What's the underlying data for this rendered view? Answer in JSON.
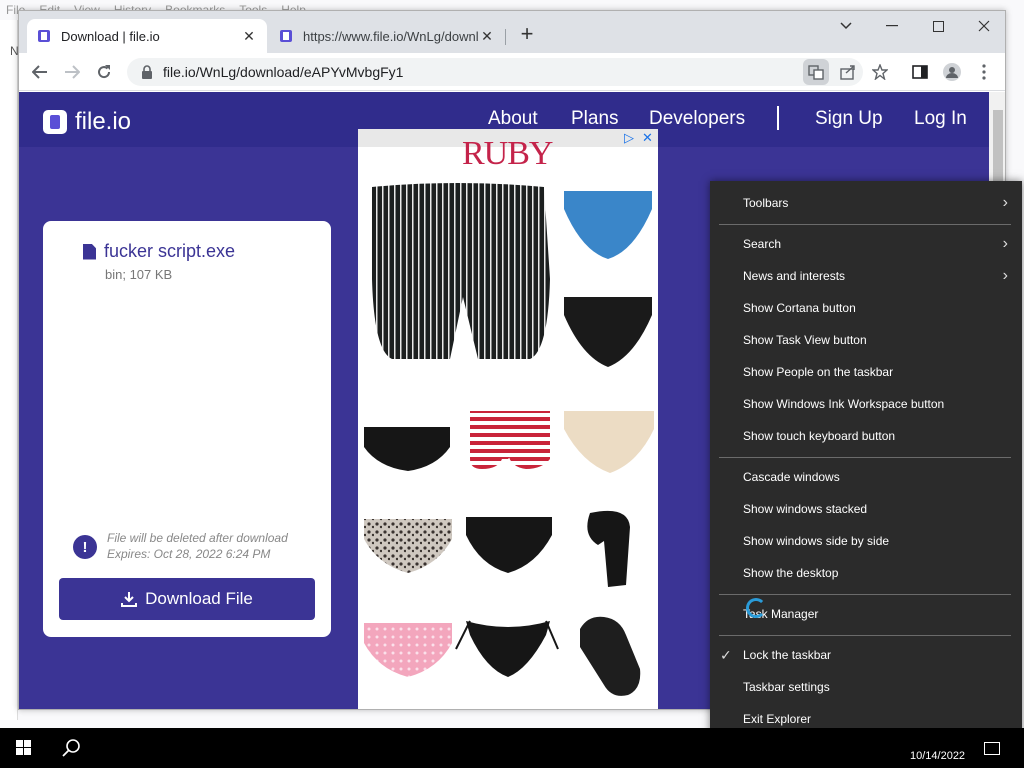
{
  "background_app": {
    "menu": [
      "File",
      "Edit",
      "View",
      "History",
      "Bookmarks",
      "Tools",
      "Help"
    ],
    "side_letters": [
      "N"
    ]
  },
  "browser": {
    "tabs": [
      {
        "title": "Download | file.io",
        "active": true
      },
      {
        "title": "https://www.file.io/WnLg/downlo",
        "active": false
      }
    ],
    "address": "file.io/WnLg/download/eAPYvMvbgFy1"
  },
  "site": {
    "logo_text": "file.io",
    "nav": [
      "About",
      "Plans",
      "Developers",
      "Sign Up",
      "Log In"
    ],
    "file": {
      "name": "fucker script.exe",
      "meta": "bin; 107 KB",
      "warning_line1": "File will be deleted after download",
      "warning_line2": "Expires: Oct 28, 2022 6:24 PM",
      "download_label": "Download File"
    },
    "ad": {
      "brand": "RUBY",
      "close": "✕",
      "adchoices": "▷"
    }
  },
  "context_menu": {
    "items": [
      {
        "label": "Toolbars",
        "submenu": true
      },
      {
        "label": "Search",
        "submenu": true
      },
      {
        "label": "News and interests",
        "submenu": true
      },
      {
        "label": "Show Cortana button"
      },
      {
        "label": "Show Task View button"
      },
      {
        "label": "Show People on the taskbar"
      },
      {
        "label": "Show Windows Ink Workspace button"
      },
      {
        "label": "Show touch keyboard button"
      },
      {
        "label": "Cascade windows"
      },
      {
        "label": "Show windows stacked"
      },
      {
        "label": "Show windows side by side"
      },
      {
        "label": "Show the desktop"
      },
      {
        "label": "Task Manager"
      },
      {
        "label": "Lock the taskbar",
        "checked": true
      },
      {
        "label": "Taskbar settings"
      },
      {
        "label": "Exit Explorer"
      }
    ]
  },
  "taskbar": {
    "date": "10/14/2022"
  }
}
